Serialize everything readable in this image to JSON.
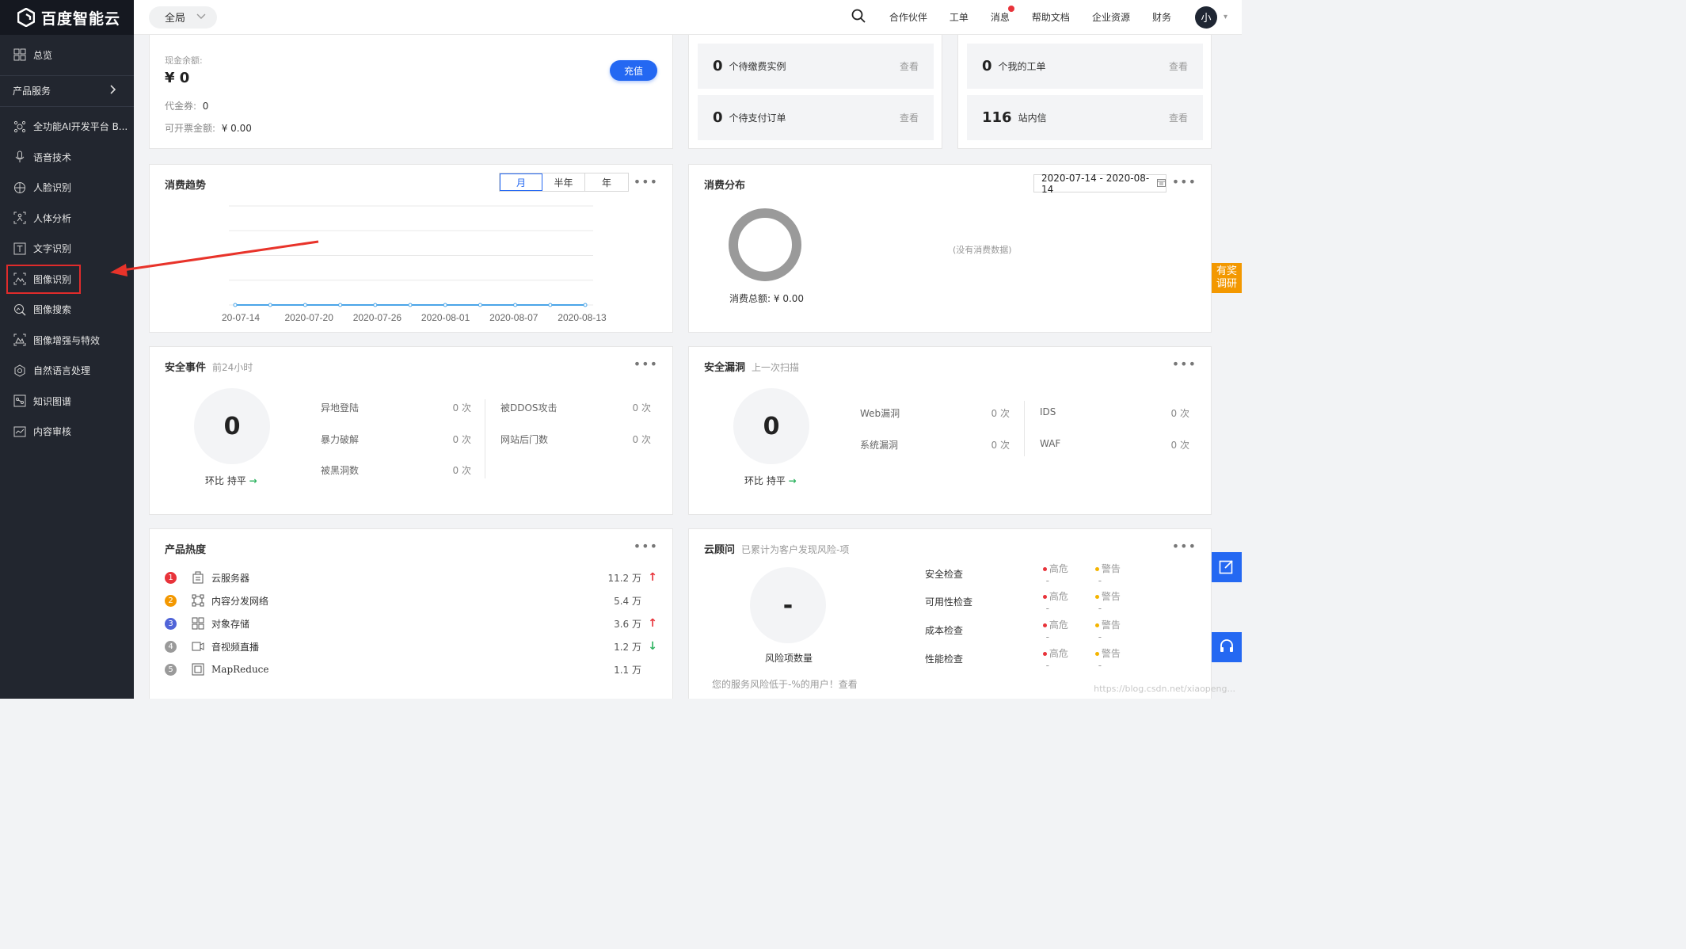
{
  "brand": {
    "name": "百度智能云",
    "logo_icon": "hexagon-logo-icon"
  },
  "sidebar": {
    "overview": {
      "label": "总览",
      "icon": "grid-icon"
    },
    "section": {
      "label": "产品服务",
      "icon": "chevron-right-icon"
    },
    "items": [
      {
        "label": "全功能AI开发平台 B...",
        "icon": "ai-platform-icon"
      },
      {
        "label": "语音技术",
        "icon": "microphone-icon"
      },
      {
        "label": "人脸识别",
        "icon": "face-icon"
      },
      {
        "label": "人体分析",
        "icon": "body-scan-icon"
      },
      {
        "label": "文字识别",
        "icon": "text-icon"
      },
      {
        "label": "图像识别",
        "icon": "image-recognition-icon",
        "active": true
      },
      {
        "label": "图像搜索",
        "icon": "image-search-icon"
      },
      {
        "label": "图像增强与特效",
        "icon": "image-enhance-icon"
      },
      {
        "label": "自然语言处理",
        "icon": "nlp-icon"
      },
      {
        "label": "知识图谱",
        "icon": "knowledge-graph-icon"
      },
      {
        "label": "内容审核",
        "icon": "content-review-icon"
      }
    ]
  },
  "topbar": {
    "scope_label": "全局",
    "nav": [
      "合作伙伴",
      "工单",
      "消息",
      "帮助文档",
      "企业资源",
      "财务"
    ],
    "avatar_text": "小"
  },
  "account": {
    "cash_label": "现金余额:",
    "cash_value": "¥ 0",
    "recharge_button": "充值",
    "voucher_label": "代金券:",
    "voucher_value": "0",
    "invoice_label": "可开票金额:",
    "invoice_value": "¥ 0.00"
  },
  "pending": {
    "renew_count": "0",
    "renew_label": "个待缴费实例",
    "pay_count": "0",
    "pay_label": "个待支付订单",
    "view_label": "查看"
  },
  "tickets": {
    "my_count": "0",
    "my_label": "个我的工单",
    "mail_count": "116",
    "mail_label": "站内信",
    "view_label": "查看"
  },
  "trend": {
    "title": "消费趋势",
    "tabs": [
      "月",
      "半年",
      "年"
    ],
    "active_tab": "月",
    "more": "•••"
  },
  "chart_data": {
    "type": "line",
    "x_ticks": [
      "20-07-14",
      "2020-07-20",
      "2020-07-26",
      "2020-08-01",
      "2020-08-07",
      "2020-08-13"
    ],
    "x": [
      "2020-07-14",
      "2020-07-17",
      "2020-07-20",
      "2020-07-23",
      "2020-07-26",
      "2020-07-29",
      "2020-08-01",
      "2020-08-04",
      "2020-08-07",
      "2020-08-10",
      "2020-08-13"
    ],
    "series": [
      {
        "values": [
          0,
          0,
          0,
          0,
          0,
          0,
          0,
          0,
          0,
          0,
          0
        ]
      }
    ],
    "grid": true,
    "color": "#4aa5e8"
  },
  "distribution": {
    "title": "消费分布",
    "date_range": "2020-07-14 - 2020-08-14",
    "empty_text": "(没有消费数据)",
    "total_label": "消费总额:",
    "total_value": "¥ 0.00",
    "more": "•••"
  },
  "security_events": {
    "title": "安全事件",
    "subtitle": "前24小时",
    "count": "0",
    "compare_label": "环比 持平",
    "compare_icon": "arrow-right-icon",
    "stats": [
      {
        "label": "异地登陆",
        "value": "0 次"
      },
      {
        "label": "被DDOS攻击",
        "value": "0 次"
      },
      {
        "label": "暴力破解",
        "value": "0 次"
      },
      {
        "label": "网站后门数",
        "value": "0 次"
      },
      {
        "label": "被黑洞数",
        "value": "0 次"
      }
    ],
    "more": "•••"
  },
  "security_vuln": {
    "title": "安全漏洞",
    "subtitle": "上一次扫描",
    "count": "0",
    "compare_label": "环比 持平",
    "stats": [
      {
        "label": "Web漏洞",
        "value": "0 次"
      },
      {
        "label": "IDS",
        "value": "0 次"
      },
      {
        "label": "系统漏洞",
        "value": "0 次"
      },
      {
        "label": "WAF",
        "value": "0 次"
      }
    ],
    "more": "•••"
  },
  "product_heat": {
    "title": "产品热度",
    "items": [
      {
        "rank": "1",
        "color": "#e8333a",
        "icon": "server-icon",
        "name": "云服务器",
        "value": "11.2 万",
        "trend": "up"
      },
      {
        "rank": "2",
        "color": "#f39800",
        "icon": "cdn-icon",
        "name": "内容分发网络",
        "value": "5.4 万",
        "trend": ""
      },
      {
        "rank": "3",
        "color": "#5064d8",
        "icon": "storage-icon",
        "name": "对象存储",
        "value": "3.6 万",
        "trend": "up"
      },
      {
        "rank": "4",
        "color": "#9a9a9a",
        "icon": "video-icon",
        "name": "音视频直播",
        "value": "1.2 万",
        "trend": "down"
      },
      {
        "rank": "5",
        "color": "#9a9a9a",
        "icon": "mapreduce-icon",
        "name": "MapReduce",
        "value": "1.1 万",
        "trend": ""
      }
    ],
    "arrows": {
      "up": "↑",
      "down": "↓"
    },
    "more": "•••"
  },
  "cloud_advisor": {
    "title": "云顾问",
    "subtitle": "已累计为客户发现风险-项",
    "count": "-",
    "count_label": "风险项数量",
    "footer": "您的服务风险低于-%的用户！查看",
    "checks": [
      {
        "name": "安全检查",
        "high": "高危",
        "high_v": "-",
        "warn": "警告",
        "warn_v": "-"
      },
      {
        "name": "可用性检查",
        "high": "高危",
        "high_v": "-",
        "warn": "警告",
        "warn_v": "-"
      },
      {
        "name": "成本检查",
        "high": "高危",
        "high_v": "-",
        "warn": "警告",
        "warn_v": "-"
      },
      {
        "name": "性能检查",
        "high": "高危",
        "high_v": "-",
        "warn": "警告",
        "warn_v": "-"
      }
    ],
    "more": "•••"
  },
  "floating": {
    "survey_label": "有奖调研",
    "edit_icon": "edit-icon",
    "support_icon": "headset-icon"
  },
  "watermark": "https://blog.csdn.net/xiaopeng..."
}
